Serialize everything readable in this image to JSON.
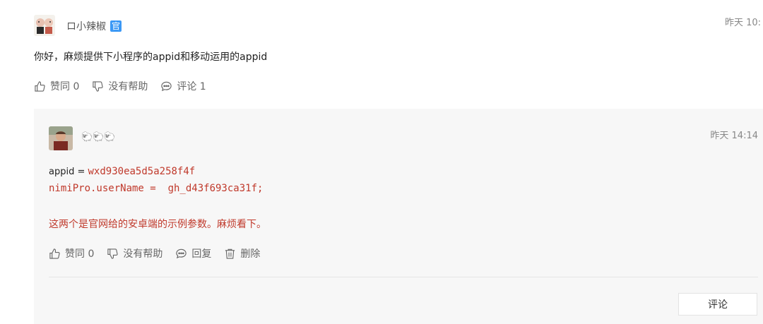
{
  "post": {
    "author": "ロ小辣椒",
    "official_badge": "官",
    "time": "昨天 10:",
    "content": "你好，麻烦提供下小程序的appid和移动运用的appid",
    "actions": {
      "like": "赞同 0",
      "unhelpful": "没有帮助",
      "comment": "评论 1"
    }
  },
  "reply": {
    "author": "🐑🐑🐑",
    "time": "昨天 14:14",
    "appid_label": "appid = ",
    "appid_value": "wxd930ea5d5a258f4f",
    "username_line": "nimiPro.userName =  gh_d43f693ca31f;",
    "note": "这两个是官网给的安卓端的示例参数。麻烦看下。",
    "actions": {
      "like": "赞同 0",
      "unhelpful": "没有帮助",
      "reply": "回复",
      "delete": "删除"
    },
    "comment_button": "评论"
  }
}
